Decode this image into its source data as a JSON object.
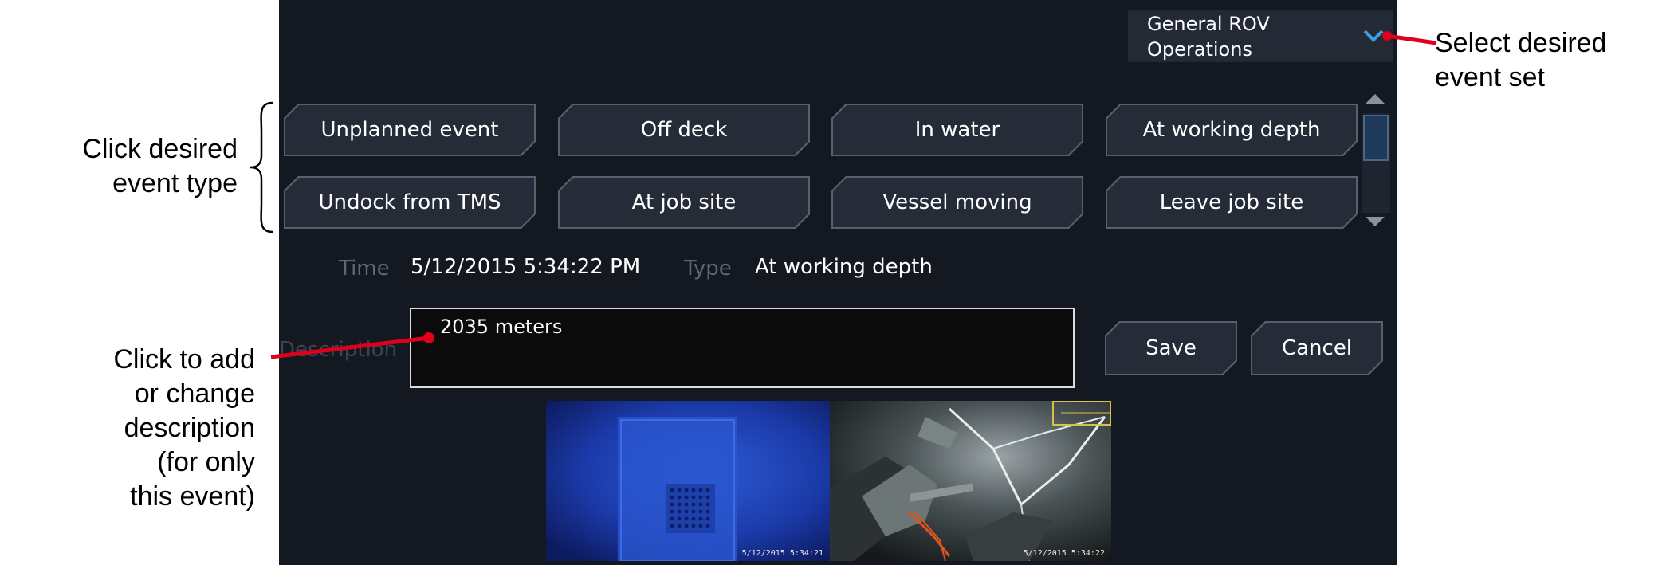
{
  "event_set": {
    "label": "General ROV Operations"
  },
  "event_buttons": [
    "Unplanned event",
    "Off deck",
    "In water",
    "At working depth",
    "Undock from TMS",
    "At job site",
    "Vessel moving",
    "Leave job site"
  ],
  "details": {
    "time_label": "Time",
    "time_value": "5/12/2015 5:34:22 PM",
    "type_label": "Type",
    "type_value": "At working depth",
    "description_label": "Description",
    "description_value": "2035 meters"
  },
  "actions": {
    "save": "Save",
    "cancel": "Cancel"
  },
  "thumbnails": [
    {
      "timestamp": "5/12/2015 5:34:21"
    },
    {
      "timestamp": "5/12/2015 5:34:22"
    }
  ],
  "annotations": {
    "event_set_note": [
      "Select desired",
      "event set"
    ],
    "event_type_note": [
      "Click desired",
      "event type"
    ],
    "description_note": [
      "Click to add",
      "or change",
      "description",
      "(for only",
      "this event)"
    ]
  },
  "colors": {
    "panel_bg": "#141921",
    "button_bg": "#262c37",
    "accent_chevron": "#3fa0e6",
    "annotation_arrow": "#e0001b"
  }
}
